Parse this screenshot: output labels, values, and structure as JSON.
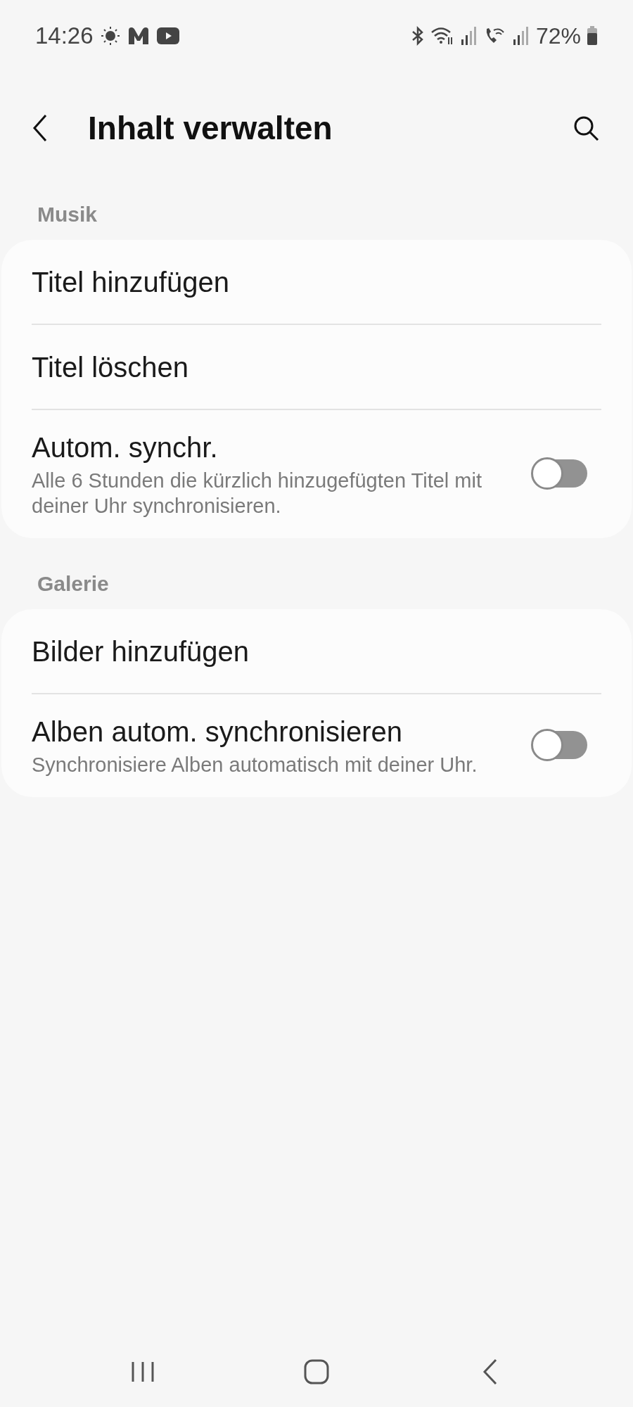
{
  "status_bar": {
    "time": "14:26",
    "battery": "72%"
  },
  "header": {
    "title": "Inhalt verwalten"
  },
  "sections": [
    {
      "title": "Musik",
      "items": [
        {
          "kind": "link",
          "label": "Titel hinzufügen"
        },
        {
          "kind": "link",
          "label": "Titel löschen"
        },
        {
          "kind": "switch",
          "label": "Autom. synchr.",
          "description": "Alle 6 Stunden die kürzlich hinzugefügten Titel mit deiner Uhr synchronisieren.",
          "on": false
        }
      ]
    },
    {
      "title": "Galerie",
      "items": [
        {
          "kind": "link",
          "label": "Bilder hinzufügen"
        },
        {
          "kind": "switch",
          "label": "Alben autom. synchronisieren",
          "description": "Synchronisiere Alben automatisch mit deiner Uhr.",
          "on": false
        }
      ]
    }
  ]
}
